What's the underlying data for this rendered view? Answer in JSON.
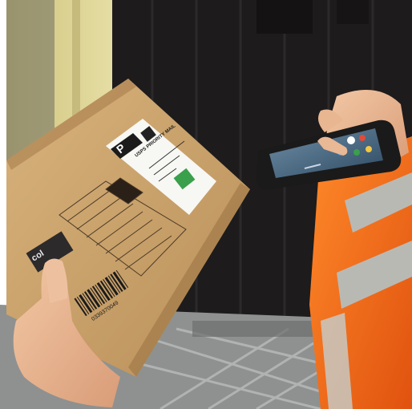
{
  "photo": {
    "label_letter": "P",
    "label_service": "USPS PRIORITY MAIL",
    "box_brand": "col",
    "barcode_number": "0339370049",
    "colors": {
      "door": "#1d1b1c",
      "box": "#c9a36f",
      "vest": "#f26a1b",
      "reflective": "#b9b9b4",
      "screen_accent": "#3aa04b",
      "floor": "#8e9190"
    }
  }
}
